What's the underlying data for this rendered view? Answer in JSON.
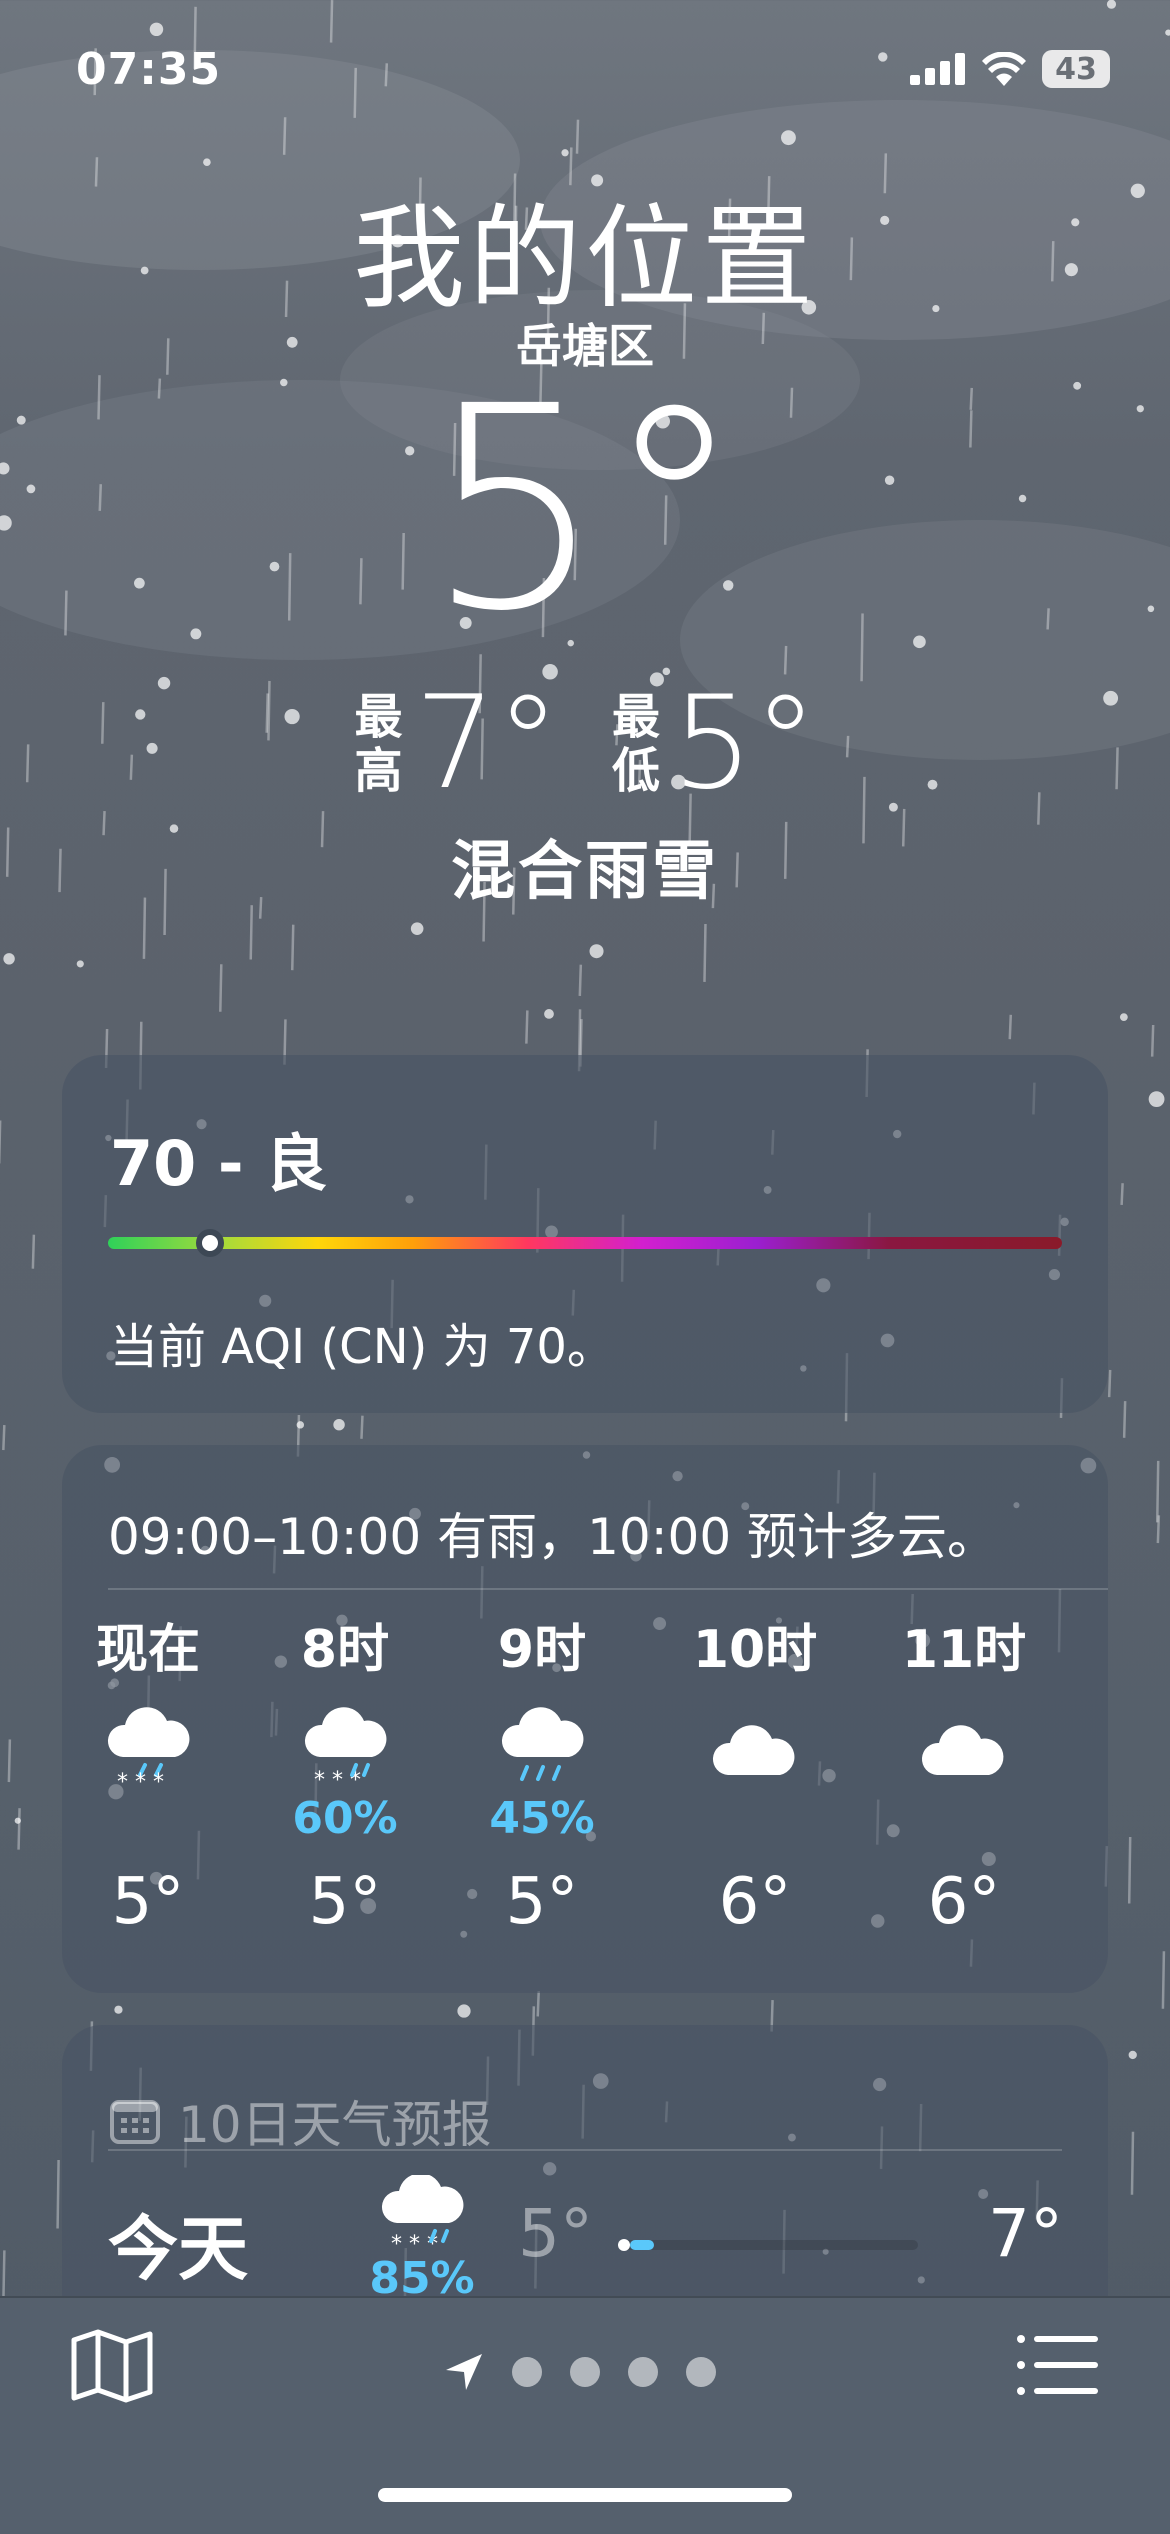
{
  "status": {
    "time": "07:35",
    "battery": "43"
  },
  "header": {
    "title": "我的位置",
    "subtitle": "岳塘区",
    "temperature": "5°",
    "high_label": "最高",
    "high": "7°",
    "low_label": "最低",
    "low": "5°",
    "condition": "混合雨雪"
  },
  "aqi": {
    "value_label": "70 - 良",
    "description": "当前 AQI (CN) 为 70。",
    "value": 70
  },
  "hourly": {
    "summary": "09:00–10:00 有雨，10:00 预计多云。",
    "items": [
      {
        "time": "现在",
        "icon": "sleet-icon",
        "precip": "",
        "temp": "5°"
      },
      {
        "time": "8时",
        "icon": "sleet-icon",
        "precip": "60%",
        "temp": "5°"
      },
      {
        "time": "9时",
        "icon": "rain-icon",
        "precip": "45%",
        "temp": "5°"
      },
      {
        "time": "10时",
        "icon": "cloud-icon",
        "precip": "",
        "temp": "6°"
      },
      {
        "time": "11时",
        "icon": "cloud-icon",
        "precip": "",
        "temp": "6°"
      }
    ]
  },
  "daily": {
    "header": "10日天气预报",
    "rows": [
      {
        "day": "今天",
        "icon": "sleet-icon",
        "precip": "85%",
        "low": "5°",
        "high": "7°"
      }
    ]
  },
  "colors": {
    "precip": "#5ac8fa",
    "aqi_good": "#2fd159"
  },
  "toolbar": {
    "icons": [
      "map-icon",
      "location-arrow-icon",
      "list-icon"
    ],
    "page_count": 4
  }
}
